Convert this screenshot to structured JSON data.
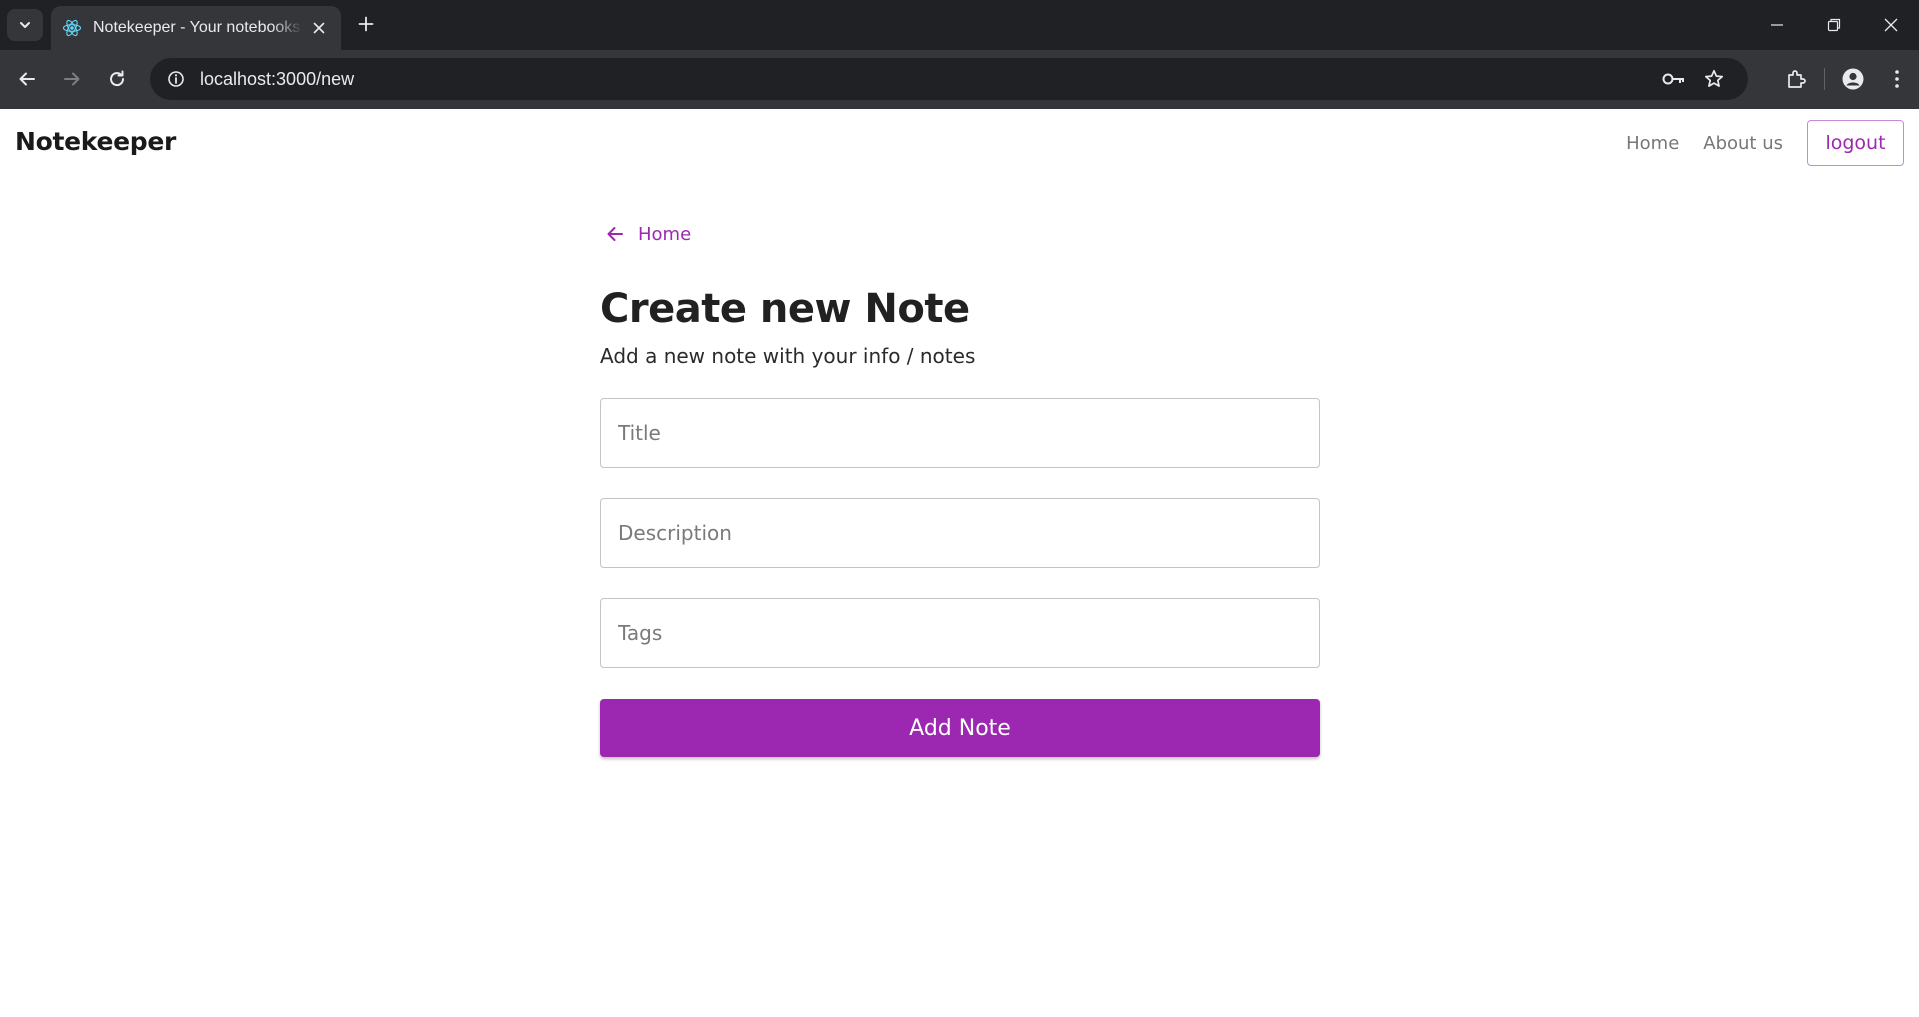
{
  "browser": {
    "tab_title": "Notekeeper - Your notebooks on the cloud",
    "url": "localhost:3000/new"
  },
  "navbar": {
    "brand": "Notekeeper",
    "links": [
      "Home",
      "About us"
    ],
    "logout_label": "logout"
  },
  "main": {
    "back_link_label": "Home",
    "heading": "Create new Note",
    "subheading": "Add a new note with your info / notes",
    "fields": {
      "title_placeholder": "Title",
      "title_value": "",
      "description_placeholder": "Description",
      "description_value": "",
      "tags_placeholder": "Tags",
      "tags_value": ""
    },
    "submit_label": "Add Note"
  },
  "colors": {
    "accent": "#9c27b0",
    "tabstrip": "#202124",
    "toolbar": "#35363a"
  }
}
